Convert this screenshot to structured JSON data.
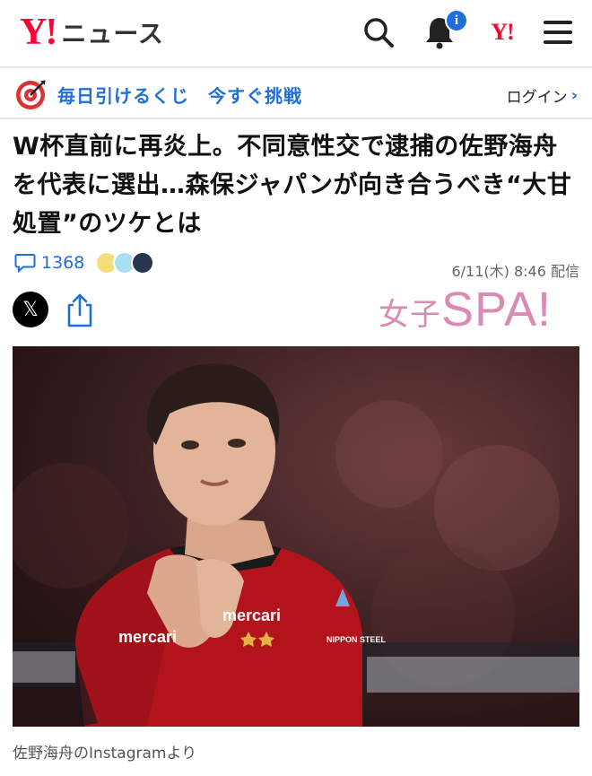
{
  "header": {
    "logo_y": "Y!",
    "logo_news": "ニュース",
    "notification_badge": "i",
    "yj_logo": "Y!",
    "icons": [
      "search-icon",
      "bell-icon",
      "yahoo-japan-icon",
      "menu-icon"
    ]
  },
  "promo": {
    "text": "毎日引けるくじ　今すぐ挑戦",
    "login_label": "ログイン",
    "login_chevron": "›",
    "icon": "target-icon",
    "accent_color": "#1e6fd9"
  },
  "article": {
    "headline": "W杯直前に再炎上。不同意性交で逮捕の佐野海舟を代表に選出…森保ジャパンが向き合うべき“大甘処置”のツケとは",
    "comment_count": "1368",
    "date": "6/11(木) 8:46 配信",
    "publisher_jp": "女子",
    "publisher_spa": "SPA!",
    "x_label": "𝕏",
    "photo_caption": "佐野海舟のInstagramより",
    "jersey_texts": [
      "mercari",
      "mercari",
      "NIPPON STEEL"
    ]
  }
}
